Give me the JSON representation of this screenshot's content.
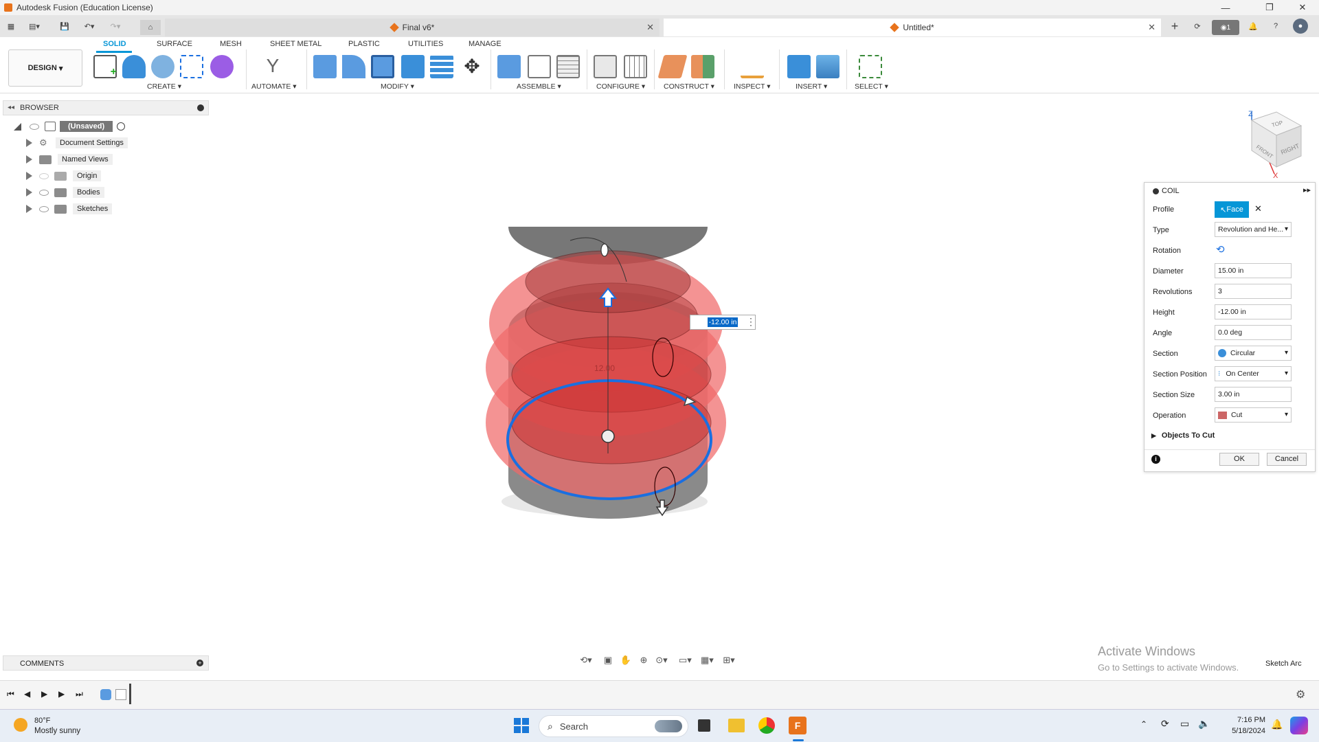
{
  "titlebar": {
    "title": "Autodesk Fusion (Education License)"
  },
  "tabs": [
    {
      "label": "Final v6*"
    },
    {
      "label": "Untitled*"
    }
  ],
  "notifications": {
    "count": "1"
  },
  "workspace_tabs": [
    "SOLID",
    "SURFACE",
    "MESH",
    "SHEET METAL",
    "PLASTIC",
    "UTILITIES",
    "MANAGE"
  ],
  "design_button": "DESIGN",
  "groups": [
    "CREATE",
    "AUTOMATE",
    "MODIFY",
    "ASSEMBLE",
    "CONFIGURE",
    "CONSTRUCT",
    "INSPECT",
    "INSERT",
    "SELECT"
  ],
  "browser": {
    "header": "BROWSER",
    "root": "(Unsaved)",
    "items": [
      "Document Settings",
      "Named Views",
      "Origin",
      "Bodies",
      "Sketches"
    ]
  },
  "viewcube": {
    "top": "TOP",
    "front": "FRONT",
    "right": "RIGHT",
    "z": "Z",
    "x": "X"
  },
  "viewport": {
    "dimension_input": "-12.00 in",
    "ghost_label": "12.00"
  },
  "coil": {
    "title": "COIL",
    "rows": {
      "profile": {
        "label": "Profile",
        "value": "Face"
      },
      "type": {
        "label": "Type",
        "value": "Revolution and He..."
      },
      "rotation": {
        "label": "Rotation"
      },
      "diameter": {
        "label": "Diameter",
        "value": "15.00 in"
      },
      "revolutions": {
        "label": "Revolutions",
        "value": "3"
      },
      "height": {
        "label": "Height",
        "value": "-12.00 in"
      },
      "angle": {
        "label": "Angle",
        "value": "0.0 deg"
      },
      "section": {
        "label": "Section",
        "value": "Circular"
      },
      "section_position": {
        "label": "Section Position",
        "value": "On Center"
      },
      "section_size": {
        "label": "Section Size",
        "value": "3.00 in"
      },
      "operation": {
        "label": "Operation",
        "value": "Cut"
      }
    },
    "objects_to_cut": "Objects To Cut",
    "ok": "OK",
    "cancel": "Cancel"
  },
  "comments": "COMMENTS",
  "watermark": {
    "line1": "Activate Windows",
    "line2": "Go to Settings to activate Windows."
  },
  "status_text": "Sketch Arc",
  "taskbar": {
    "weather_temp": "80°F",
    "weather_desc": "Mostly sunny",
    "search_placeholder": "Search",
    "time": "7:16 PM",
    "date": "5/18/2024"
  },
  "colors": {
    "accent": "#0696d7",
    "coil_fill": "#f06a6a",
    "body": "#8a8a8a",
    "profile_ring": "#1a6fe0"
  }
}
